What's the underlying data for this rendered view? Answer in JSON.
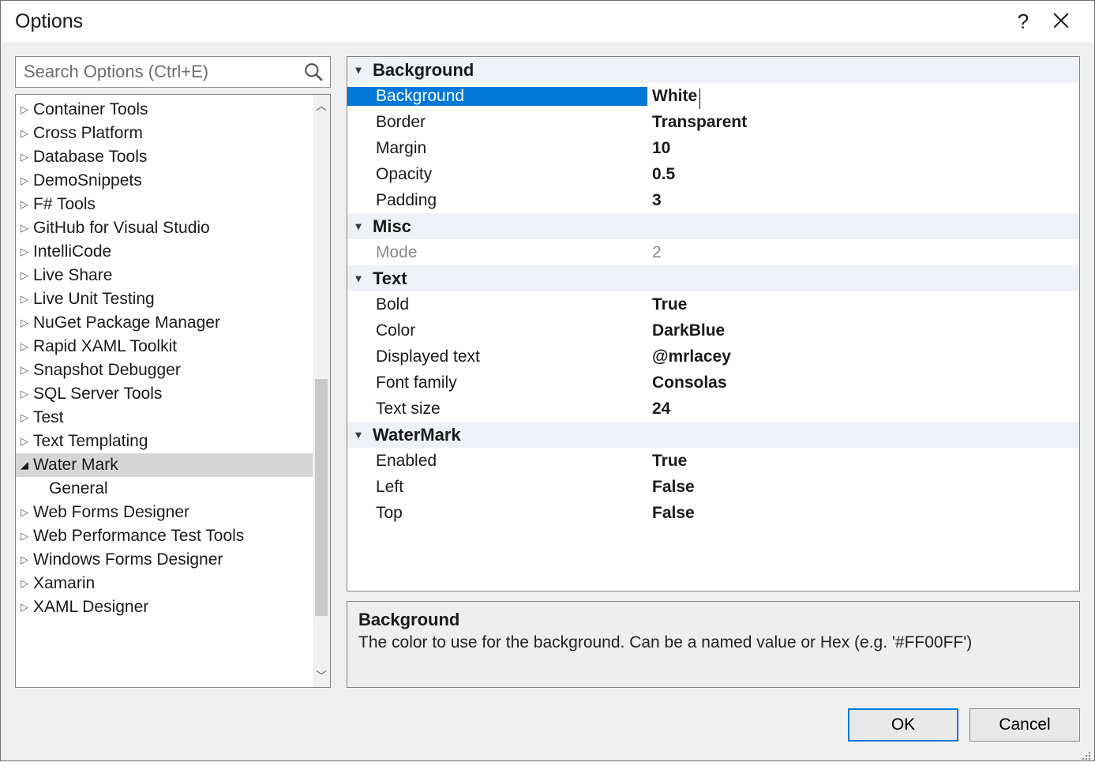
{
  "window": {
    "title": "Options"
  },
  "search": {
    "placeholder": "Search Options (Ctrl+E)"
  },
  "tree": {
    "items": [
      {
        "label": "Container Tools",
        "expanded": false,
        "selected": false
      },
      {
        "label": "Cross Platform",
        "expanded": false,
        "selected": false
      },
      {
        "label": "Database Tools",
        "expanded": false,
        "selected": false
      },
      {
        "label": "DemoSnippets",
        "expanded": false,
        "selected": false
      },
      {
        "label": "F# Tools",
        "expanded": false,
        "selected": false
      },
      {
        "label": "GitHub for Visual Studio",
        "expanded": false,
        "selected": false
      },
      {
        "label": "IntelliCode",
        "expanded": false,
        "selected": false
      },
      {
        "label": "Live Share",
        "expanded": false,
        "selected": false
      },
      {
        "label": "Live Unit Testing",
        "expanded": false,
        "selected": false
      },
      {
        "label": "NuGet Package Manager",
        "expanded": false,
        "selected": false
      },
      {
        "label": "Rapid XAML Toolkit",
        "expanded": false,
        "selected": false
      },
      {
        "label": "Snapshot Debugger",
        "expanded": false,
        "selected": false
      },
      {
        "label": "SQL Server Tools",
        "expanded": false,
        "selected": false
      },
      {
        "label": "Test",
        "expanded": false,
        "selected": false
      },
      {
        "label": "Text Templating",
        "expanded": false,
        "selected": false
      },
      {
        "label": "Water Mark",
        "expanded": true,
        "selected": true
      },
      {
        "label": "General",
        "child": true,
        "selected": false
      },
      {
        "label": "Web Forms Designer",
        "expanded": false,
        "selected": false
      },
      {
        "label": "Web Performance Test Tools",
        "expanded": false,
        "selected": false
      },
      {
        "label": "Windows Forms Designer",
        "expanded": false,
        "selected": false
      },
      {
        "label": "Xamarin",
        "expanded": false,
        "selected": false
      },
      {
        "label": "XAML Designer",
        "expanded": false,
        "selected": false
      }
    ]
  },
  "propgrid": {
    "categories": [
      {
        "name": "Background",
        "props": [
          {
            "name": "Background",
            "value": "White",
            "selected": true
          },
          {
            "name": "Border",
            "value": "Transparent"
          },
          {
            "name": "Margin",
            "value": "10"
          },
          {
            "name": "Opacity",
            "value": "0.5"
          },
          {
            "name": "Padding",
            "value": "3"
          }
        ]
      },
      {
        "name": "Misc",
        "props": [
          {
            "name": "Mode",
            "value": "2",
            "disabled": true
          }
        ]
      },
      {
        "name": "Text",
        "props": [
          {
            "name": "Bold",
            "value": "True"
          },
          {
            "name": "Color",
            "value": "DarkBlue"
          },
          {
            "name": "Displayed text",
            "value": "@mrlacey"
          },
          {
            "name": "Font family",
            "value": "Consolas"
          },
          {
            "name": "Text size",
            "value": "24"
          }
        ]
      },
      {
        "name": "WaterMark",
        "props": [
          {
            "name": "Enabled",
            "value": "True"
          },
          {
            "name": "Left",
            "value": "False"
          },
          {
            "name": "Top",
            "value": "False"
          }
        ]
      }
    ]
  },
  "help": {
    "title": "Background",
    "desc": "The color to use for the background. Can be a named value or Hex (e.g. '#FF00FF')"
  },
  "buttons": {
    "ok": "OK",
    "cancel": "Cancel"
  }
}
